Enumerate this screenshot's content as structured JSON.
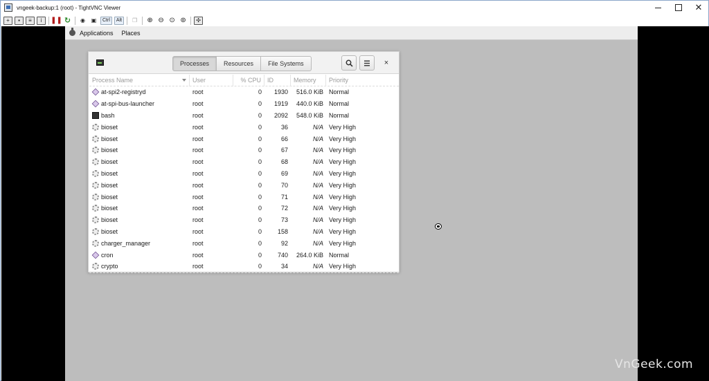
{
  "window": {
    "title": "vngeek-backup:1 (root) - TightVNC Viewer",
    "controls": {
      "minimize": "",
      "maximize": "",
      "close": "✕"
    }
  },
  "toolbar": {
    "ctrl_label": "Ctrl",
    "alt_label": "Alt"
  },
  "gnome_panel": {
    "applications": "Applications",
    "places": "Places"
  },
  "system_monitor": {
    "tabs": [
      "Processes",
      "Resources",
      "File Systems"
    ],
    "active_tab": "Processes",
    "search_icon": "search-icon",
    "menu_icon": "hamburger-menu-icon",
    "close_label": "×",
    "columns": [
      "Process Name",
      "User",
      "% CPU",
      "ID",
      "Memory",
      "Priority"
    ],
    "rows": [
      {
        "icon": "diamond",
        "name": "at-spi2-registryd",
        "user": "root",
        "cpu": "0",
        "id": "1930",
        "memory": "516.0 KiB",
        "priority": "Normal"
      },
      {
        "icon": "diamond",
        "name": "at-spi-bus-launcher",
        "user": "root",
        "cpu": "0",
        "id": "1919",
        "memory": "440.0 KiB",
        "priority": "Normal"
      },
      {
        "icon": "terminal",
        "name": "bash",
        "user": "root",
        "cpu": "0",
        "id": "2092",
        "memory": "548.0 KiB",
        "priority": "Normal"
      },
      {
        "icon": "gear",
        "name": "bioset",
        "user": "root",
        "cpu": "0",
        "id": "36",
        "memory": "N/A",
        "priority": "Very High"
      },
      {
        "icon": "gear",
        "name": "bioset",
        "user": "root",
        "cpu": "0",
        "id": "66",
        "memory": "N/A",
        "priority": "Very High"
      },
      {
        "icon": "gear",
        "name": "bioset",
        "user": "root",
        "cpu": "0",
        "id": "67",
        "memory": "N/A",
        "priority": "Very High"
      },
      {
        "icon": "gear",
        "name": "bioset",
        "user": "root",
        "cpu": "0",
        "id": "68",
        "memory": "N/A",
        "priority": "Very High"
      },
      {
        "icon": "gear",
        "name": "bioset",
        "user": "root",
        "cpu": "0",
        "id": "69",
        "memory": "N/A",
        "priority": "Very High"
      },
      {
        "icon": "gear",
        "name": "bioset",
        "user": "root",
        "cpu": "0",
        "id": "70",
        "memory": "N/A",
        "priority": "Very High"
      },
      {
        "icon": "gear",
        "name": "bioset",
        "user": "root",
        "cpu": "0",
        "id": "71",
        "memory": "N/A",
        "priority": "Very High"
      },
      {
        "icon": "gear",
        "name": "bioset",
        "user": "root",
        "cpu": "0",
        "id": "72",
        "memory": "N/A",
        "priority": "Very High"
      },
      {
        "icon": "gear",
        "name": "bioset",
        "user": "root",
        "cpu": "0",
        "id": "73",
        "memory": "N/A",
        "priority": "Very High"
      },
      {
        "icon": "gear",
        "name": "bioset",
        "user": "root",
        "cpu": "0",
        "id": "158",
        "memory": "N/A",
        "priority": "Very High"
      },
      {
        "icon": "gear",
        "name": "charger_manager",
        "user": "root",
        "cpu": "0",
        "id": "92",
        "memory": "N/A",
        "priority": "Very High"
      },
      {
        "icon": "diamond",
        "name": "cron",
        "user": "root",
        "cpu": "0",
        "id": "740",
        "memory": "264.0 KiB",
        "priority": "Normal"
      },
      {
        "icon": "gear",
        "name": "crypto",
        "user": "root",
        "cpu": "0",
        "id": "34",
        "memory": "N/A",
        "priority": "Very High"
      }
    ]
  },
  "watermark": "VnGeek.com"
}
